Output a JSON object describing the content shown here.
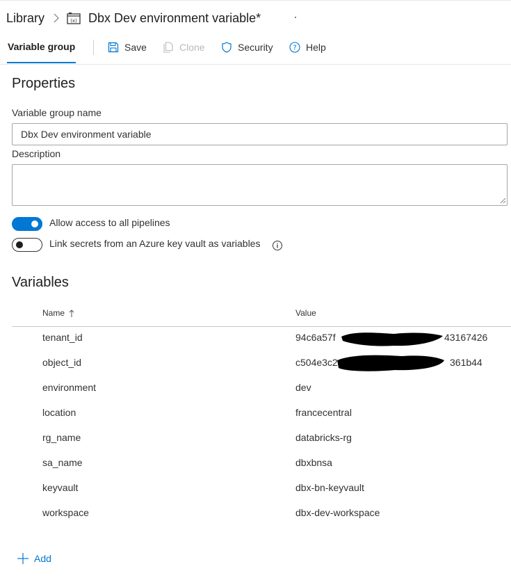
{
  "breadcrumb": {
    "root": "Library",
    "title": "Dbx Dev environment variable*"
  },
  "toolbar": {
    "active_tab": "Variable group",
    "save": "Save",
    "clone": "Clone",
    "security": "Security",
    "help": "Help"
  },
  "properties": {
    "title": "Properties",
    "name_label": "Variable group name",
    "name_value": "Dbx Dev environment variable",
    "description_label": "Description",
    "description_value": "",
    "allow_access_label": "Allow access to all pipelines",
    "allow_access_on": true,
    "link_secrets_label": "Link secrets from an Azure key vault as variables",
    "link_secrets_on": false
  },
  "variables": {
    "title": "Variables",
    "col_name": "Name",
    "col_value": "Value",
    "rows": [
      {
        "name": "tenant_id",
        "value": "94c6a57f",
        "value_suffix": "43167426"
      },
      {
        "name": "object_id",
        "value": "c504e3c2",
        "value_suffix": "361b44"
      },
      {
        "name": "environment",
        "value": "dev"
      },
      {
        "name": "location",
        "value": "francecentral"
      },
      {
        "name": "rg_name",
        "value": "databricks-rg"
      },
      {
        "name": "sa_name",
        "value": "dbxbnsa"
      },
      {
        "name": "keyvault",
        "value": "dbx-bn-keyvault"
      },
      {
        "name": "workspace",
        "value": "dbx-dev-workspace"
      }
    ],
    "add_label": "Add"
  },
  "colors": {
    "accent": "#0078d4",
    "text": "#323130",
    "disabled": "#b9b9b9"
  }
}
